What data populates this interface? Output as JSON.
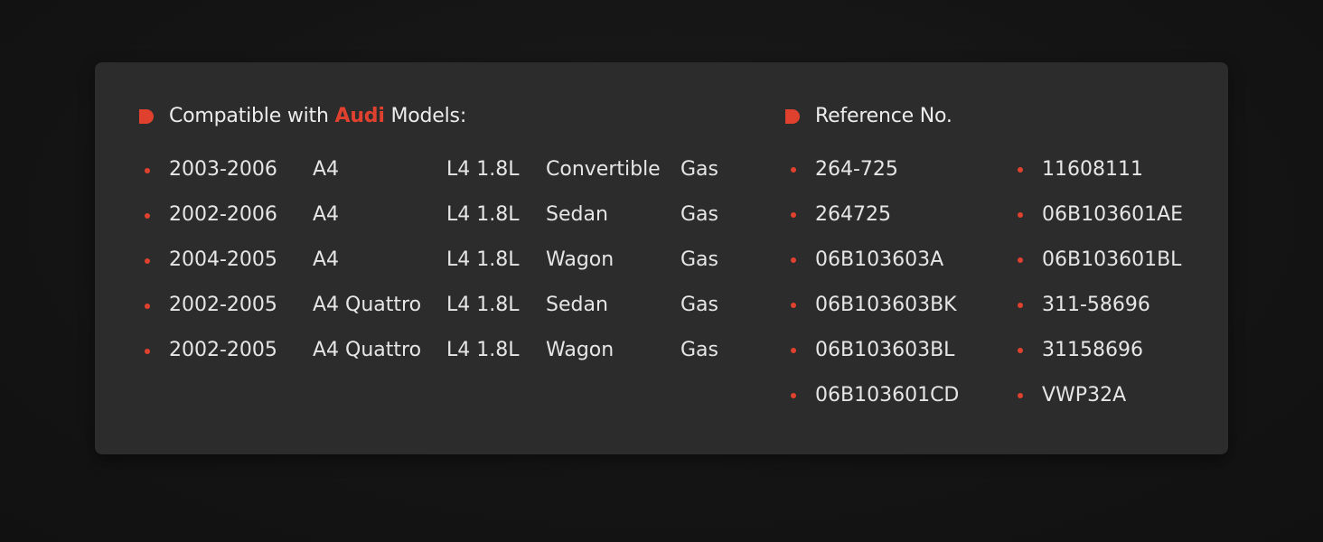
{
  "compat": {
    "heading_prefix": "Compatible with",
    "heading_brand": "Audi",
    "heading_suffix": "Models:",
    "rows": [
      {
        "year": "2003-2006",
        "model": "A4",
        "engine": "L4 1.8L",
        "body": "Convertible",
        "fuel": "Gas"
      },
      {
        "year": "2002-2006",
        "model": "A4",
        "engine": "L4 1.8L",
        "body": "Sedan",
        "fuel": "Gas"
      },
      {
        "year": "2004-2005",
        "model": "A4",
        "engine": "L4 1.8L",
        "body": "Wagon",
        "fuel": "Gas"
      },
      {
        "year": "2002-2005",
        "model": "A4 Quattro",
        "engine": "L4 1.8L",
        "body": "Sedan",
        "fuel": "Gas"
      },
      {
        "year": "2002-2005",
        "model": "A4 Quattro",
        "engine": "L4 1.8L",
        "body": "Wagon",
        "fuel": "Gas"
      }
    ]
  },
  "reference": {
    "heading": "Reference No.",
    "col1": [
      "264-725",
      "264725",
      "06B103603A",
      "06B103603BK",
      "06B103603BL",
      "06B103601CD"
    ],
    "col2": [
      "11608111",
      "06B103601AE",
      "06B103601BL",
      "311-58696",
      "31158696",
      "VWP32A"
    ]
  },
  "colors": {
    "accent": "#e0412e",
    "card": "#2c2c2c",
    "background": "#141414",
    "text": "#e6e6e6"
  },
  "icons": {
    "heading_marker": "d-shape-marker-icon",
    "bullet": "dot-bullet-icon"
  }
}
